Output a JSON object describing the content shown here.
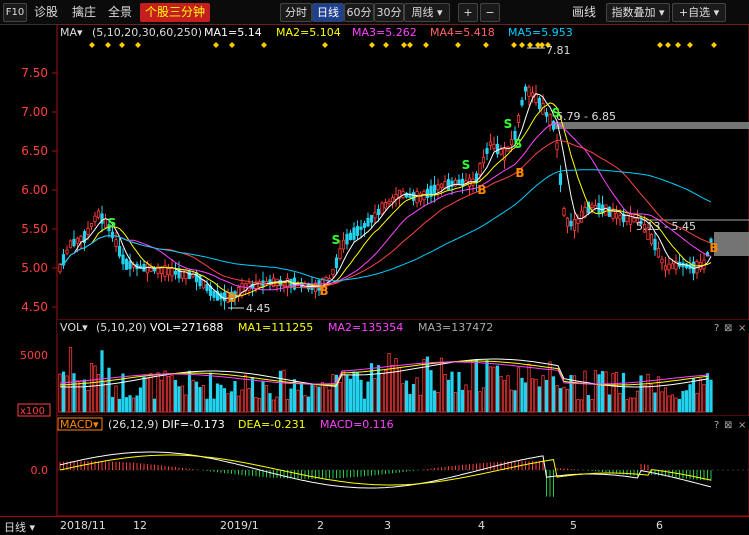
{
  "toolbar": {
    "f10": "F10",
    "diagnose": "诊股",
    "select": "擒庄",
    "panorama": "全景",
    "minute3": "个股三分钟",
    "tabs": [
      "分时",
      "日线",
      "60分",
      "30分",
      "周线 ▾"
    ],
    "plus": "+",
    "minus": "−",
    "draw": "画线",
    "overlay": "指数叠加 ▾",
    "watchlist": "+自选 ▾"
  },
  "ma": {
    "label": "MA▾",
    "params": "(5,10,20,30,60,250)",
    "ma1": "MA1=5.14",
    "ma2": "MA2=5.104",
    "ma3": "MA3=5.262",
    "ma4": "MA4=5.418",
    "ma5": "MA5=5.953"
  },
  "price_axis": [
    "7.50",
    "7.00",
    "6.50",
    "6.00",
    "5.50",
    "5.00",
    "4.50"
  ],
  "annotations": {
    "high": "7.81",
    "low": "4.45",
    "range1": "6.79 - 6.85",
    "range2": "5.13 - 5.45"
  },
  "signals": {
    "buy": "B",
    "sell": "S"
  },
  "vol": {
    "label": "VOL▾",
    "params": "(5,10,20)",
    "vol": "VOL=271688",
    "ma1": "MA1=111255",
    "ma2": "MA2=135354",
    "ma3": "MA3=137472",
    "axis": "5000",
    "unit": "x100"
  },
  "macd": {
    "label": "MACD▾",
    "params": "(26,12,9)",
    "dif": "DIF=-0.173",
    "dea": "DEA=-0.231",
    "macd": "MACD=0.116",
    "axis": "0.0"
  },
  "bottom": {
    "period": "日线 ▾",
    "dates": [
      "2018/11",
      "12",
      "2019/1",
      "2",
      "3",
      "4",
      "5",
      "6"
    ]
  },
  "colors": {
    "up": "#ff3b3b",
    "down": "#22d3ee",
    "ma1": "#ffffff",
    "ma2": "#ffff00",
    "ma3": "#ff44ff",
    "ma4": "#ff4444",
    "ma5": "#00cfff",
    "frame": "#a01010"
  }
}
